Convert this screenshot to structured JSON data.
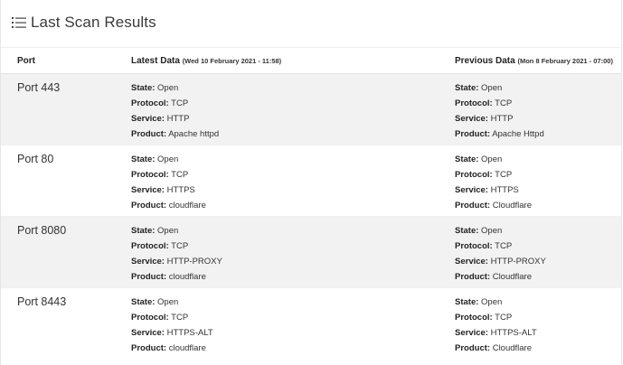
{
  "header": {
    "title": "Last Scan Results"
  },
  "table": {
    "headers": {
      "port": "Port",
      "latest": "Latest Data",
      "latest_sub": "(Wed 10 February 2021 - 11:58)",
      "previous": "Previous Data",
      "previous_sub": "(Mon 8 February 2021 - 07:00)"
    },
    "labels": {
      "state": "State:",
      "protocol": "Protocol:",
      "service": "Service:",
      "product": "Product:"
    },
    "rows": [
      {
        "port": "Port 443",
        "latest": {
          "state": "Open",
          "protocol": "TCP",
          "service": "HTTP",
          "product": "Apache httpd"
        },
        "previous": {
          "state": "Open",
          "protocol": "TCP",
          "service": "HTTP",
          "product": "Apache Httpd"
        }
      },
      {
        "port": "Port 80",
        "latest": {
          "state": "Open",
          "protocol": "TCP",
          "service": "HTTPS",
          "product": "cloudflare"
        },
        "previous": {
          "state": "Open",
          "protocol": "TCP",
          "service": "HTTPS",
          "product": "Cloudflare"
        }
      },
      {
        "port": "Port 8080",
        "latest": {
          "state": "Open",
          "protocol": "TCP",
          "service": "HTTP-PROXY",
          "product": "cloudflare"
        },
        "previous": {
          "state": "Open",
          "protocol": "TCP",
          "service": "HTTP-PROXY",
          "product": "Cloudflare"
        }
      },
      {
        "port": "Port 8443",
        "latest": {
          "state": "Open",
          "protocol": "TCP",
          "service": "HTTPS-ALT",
          "product": "cloudflare"
        },
        "previous": {
          "state": "Open",
          "protocol": "TCP",
          "service": "HTTPS-ALT",
          "product": "Cloudflare"
        }
      }
    ]
  },
  "colors": {
    "stripe": "#f2f2f2",
    "border": "#dee2e6",
    "text": "#333333"
  }
}
